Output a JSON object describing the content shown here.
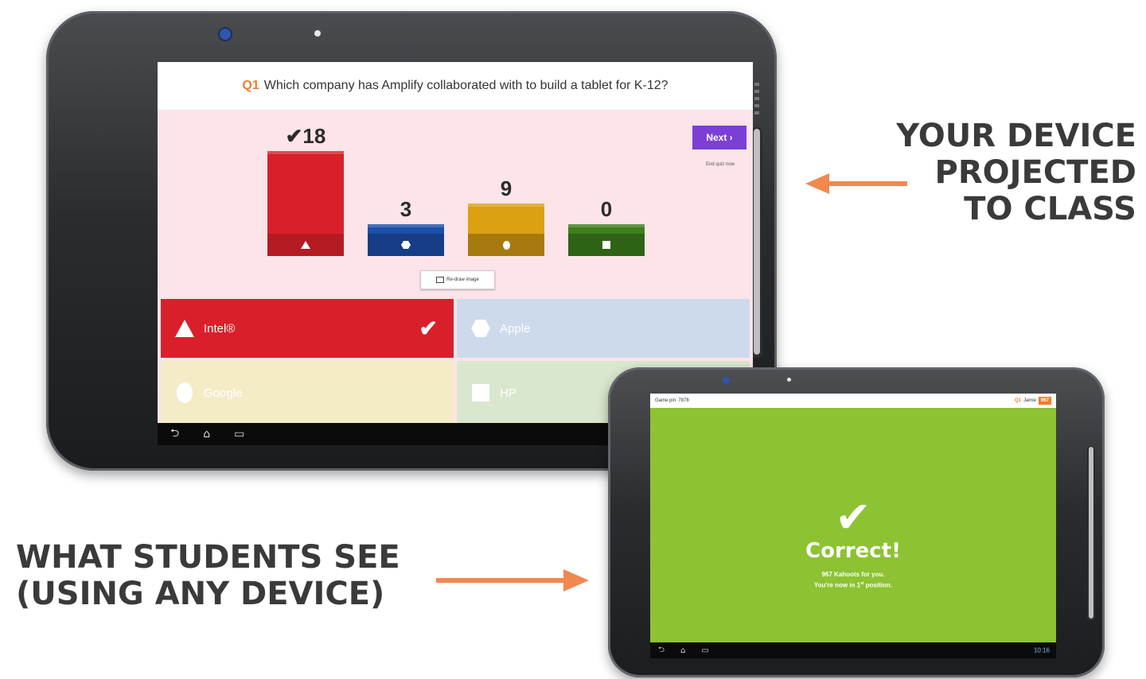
{
  "projected": {
    "question_number": "Q1",
    "question_text": "Which company has Amplify collaborated with to build a tablet for K-12?",
    "next_label": "Next ›",
    "end_quiz_label": "End quiz now",
    "redraw_label": "Re-draw image",
    "bars": [
      {
        "count": "✔18",
        "value": 18,
        "color": "#d9202a",
        "shade": "#b51b23",
        "shape": "triangle"
      },
      {
        "count": "3",
        "value": 3,
        "color": "#1d4fa8",
        "shade": "#163d85",
        "shape": "hexagon"
      },
      {
        "count": "9",
        "value": 9,
        "color": "#dba113",
        "shade": "#a67a0e",
        "shape": "circle"
      },
      {
        "count": "0",
        "value": 0,
        "color": "#3d7f1d",
        "shade": "#2e6316",
        "shape": "square"
      }
    ],
    "answers": [
      {
        "label": "Intel®",
        "shape": "triangle",
        "bg": "#d9202a",
        "check": "✔"
      },
      {
        "label": "Apple",
        "shape": "hexagon",
        "bg": "#cddaeb",
        "check": ""
      },
      {
        "label": "Google",
        "shape": "circle",
        "bg": "#f4ebc7",
        "check": ""
      },
      {
        "label": "HP",
        "shape": "square",
        "bg": "#d9e7ce",
        "check": ""
      }
    ],
    "nav_icons": [
      "back-icon",
      "home-icon",
      "recent-apps-icon"
    ]
  },
  "student": {
    "game_pin": "Game pin: 7878",
    "question_number": "Q1",
    "player": "Jamie",
    "score": "967",
    "check": "✔",
    "title": "Correct!",
    "message1": "967 Kahoots for you.",
    "message2_pre": "You're now in 1",
    "message2_sup": "st",
    "message2_post": " position.",
    "clock": "10:16",
    "bg_color": "#8dc232"
  },
  "captions": {
    "right": [
      "YOUR DEVICE",
      "PROJECTED",
      "TO CLASS"
    ],
    "left": [
      "WHAT STUDENTS SEE",
      "(USING ANY DEVICE)"
    ]
  },
  "accent_color": "#f08850"
}
